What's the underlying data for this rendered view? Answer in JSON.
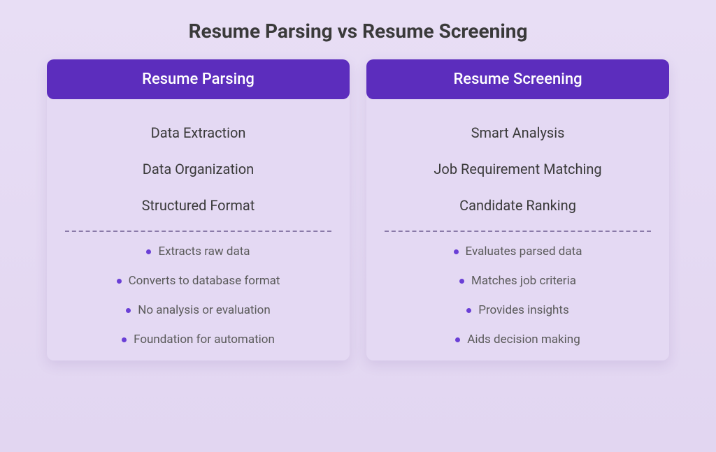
{
  "title": "Resume Parsing vs Resume Screening",
  "columns": [
    {
      "header": "Resume Parsing",
      "features": [
        "Data Extraction",
        "Data Organization",
        "Structured Format"
      ],
      "bullets": [
        "Extracts raw data",
        "Converts to database format",
        "No analysis or evaluation",
        "Foundation for automation"
      ]
    },
    {
      "header": "Resume Screening",
      "features": [
        "Smart Analysis",
        "Job Requirement Matching",
        "Candidate Ranking"
      ],
      "bullets": [
        "Evaluates parsed data",
        "Matches job criteria",
        "Provides insights",
        "Aids decision making"
      ]
    }
  ]
}
